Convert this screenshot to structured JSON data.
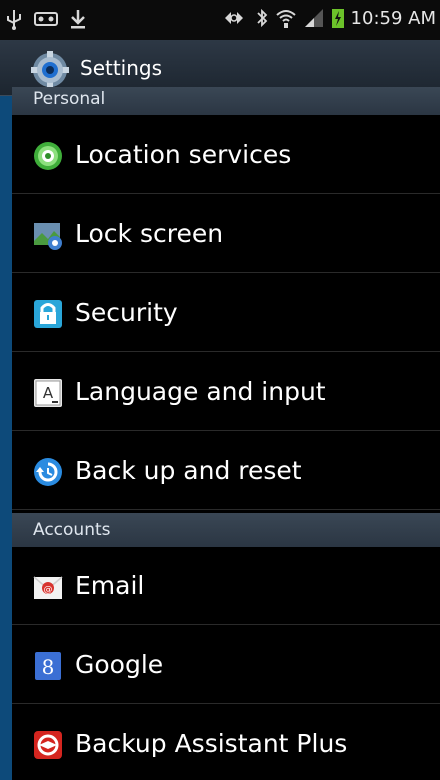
{
  "status_bar": {
    "time": "10:59 AM",
    "icons": [
      "usb-icon",
      "voicemail-icon",
      "download-icon",
      "nfc-icon",
      "bluetooth-icon",
      "wifi-icon",
      "signal-icon",
      "battery-charging-icon"
    ]
  },
  "action_bar": {
    "title": "Settings",
    "icon": "settings-gear-icon"
  },
  "sections": {
    "personal": "Personal",
    "accounts": "Accounts"
  },
  "personal_items": [
    {
      "label": "Location services",
      "icon": "location-icon"
    },
    {
      "label": "Lock screen",
      "icon": "lock-screen-icon"
    },
    {
      "label": "Security",
      "icon": "security-lock-icon"
    },
    {
      "label": "Language and input",
      "icon": "keyboard-icon"
    },
    {
      "label": "Back up and reset",
      "icon": "backup-reset-icon"
    }
  ],
  "account_items": [
    {
      "label": "Email",
      "icon": "email-icon"
    },
    {
      "label": "Google",
      "icon": "google-icon"
    },
    {
      "label": "Backup Assistant Plus",
      "icon": "backup-assistant-icon"
    }
  ],
  "colors": {
    "background": "#000000",
    "accent_blue": "#0d4a7a",
    "header": "#2b3643"
  }
}
